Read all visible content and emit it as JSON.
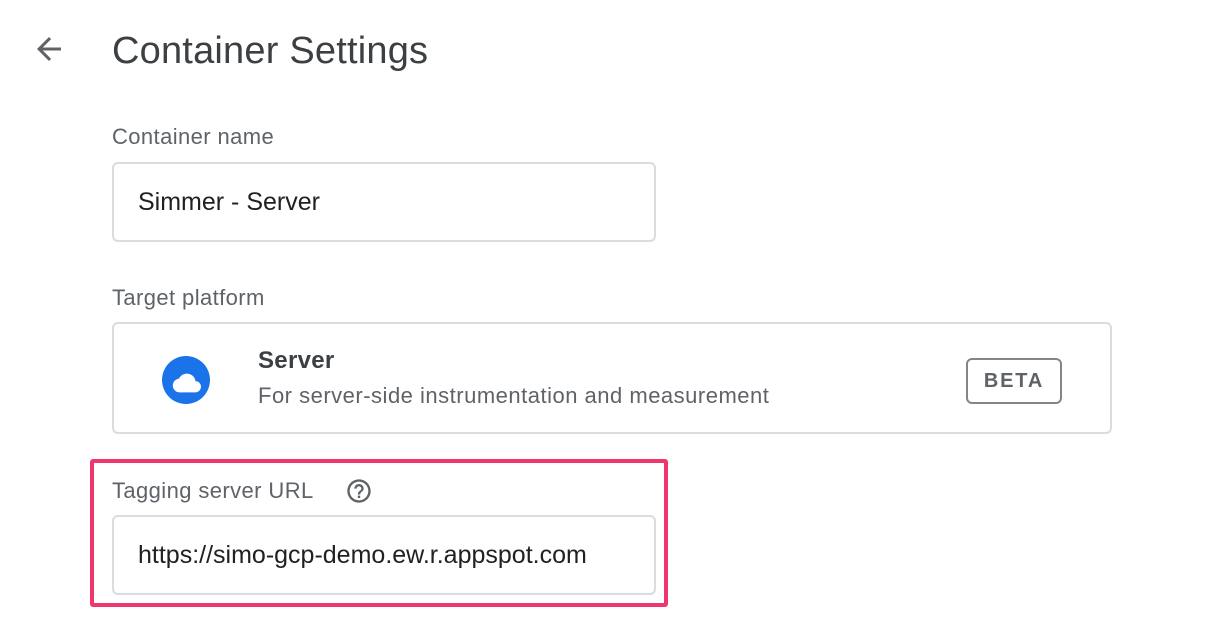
{
  "header": {
    "back_icon": "arrow-back-icon",
    "title": "Container Settings"
  },
  "container_name": {
    "label": "Container name",
    "value": "Simmer - Server"
  },
  "target_platform": {
    "label": "Target platform",
    "icon": "cloud-icon",
    "icon_color": "#1a73e8",
    "name": "Server",
    "description": "For server-side instrumentation and measurement",
    "badge": "BETA"
  },
  "tagging_server": {
    "label": "Tagging server URL",
    "help_icon": "help-circle-icon",
    "value": "https://simo-gcp-demo.ew.r.appspot.com",
    "highlight_color": "#f0366e"
  }
}
